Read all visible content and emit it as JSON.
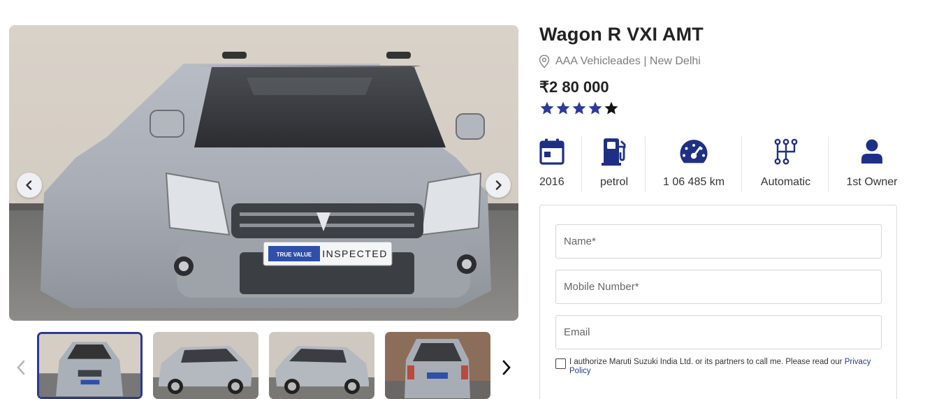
{
  "gallery": {
    "main_image_alt": "Wagon R VXI AMT front view",
    "badge_brand": "TRUE VALUE",
    "badge_text": "INSPECTED",
    "thumbnails": [
      "front",
      "side-left",
      "side-right",
      "rear"
    ],
    "active_thumbnail": 0
  },
  "listing": {
    "title": "Wagon R VXI AMT",
    "location": "AAA Vehicleades | New Delhi",
    "price": "₹2 80 000",
    "rating": 4,
    "rating_max": 5
  },
  "specs": [
    {
      "icon": "calendar-icon",
      "value": "2016"
    },
    {
      "icon": "fuel-pump-icon",
      "value": "petrol"
    },
    {
      "icon": "speedometer-icon",
      "value": "1 06 485 km"
    },
    {
      "icon": "gearbox-icon",
      "value": "Automatic"
    },
    {
      "icon": "person-icon",
      "value": "1st Owner"
    }
  ],
  "form": {
    "name_placeholder": "Name*",
    "mobile_placeholder": "Mobile Number*",
    "email_placeholder": "Email",
    "consent_text": "I authorize Maruti Suzuki India Ltd. or its partners to call me. Please read our ",
    "privacy_link": "Privacy Policy"
  },
  "colors": {
    "accent": "#243a8f",
    "star_filled": "#2b3a9b",
    "star_empty": "#111111",
    "icon": "#1f2f86"
  }
}
